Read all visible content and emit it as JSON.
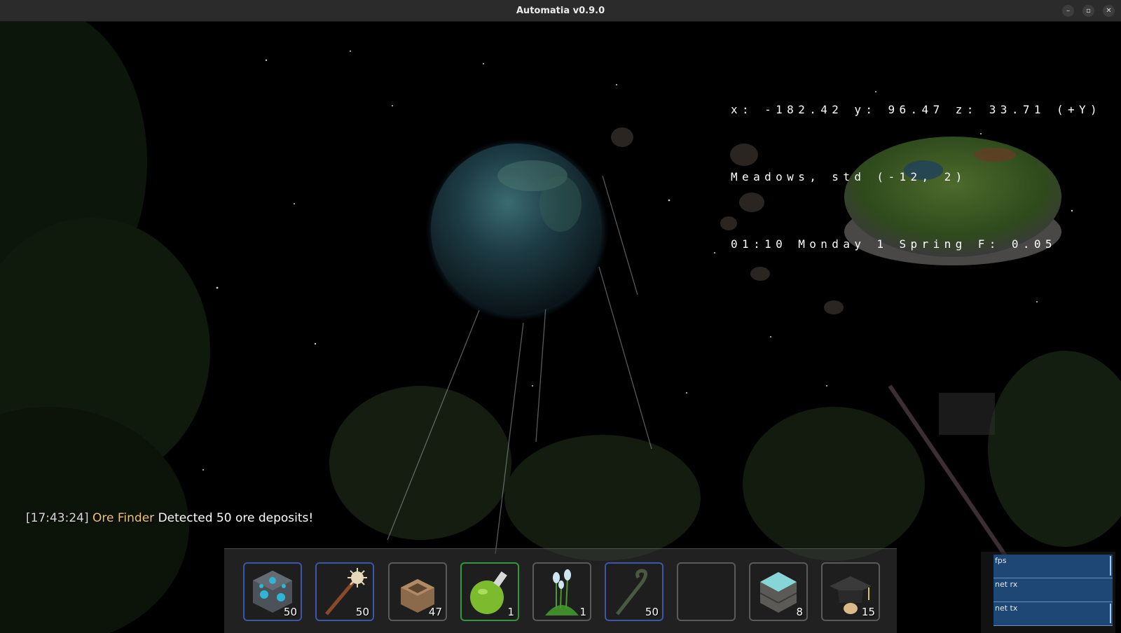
{
  "window": {
    "title": "Automatia v0.9.0",
    "controls": {
      "minimize": "–",
      "maximize": "▫",
      "close": "✕"
    }
  },
  "hud": {
    "coords_line": "x: -182.42 y: 96.47 z: 33.71 (+Y)",
    "biome_line": "Meadows, std (-12, 2)",
    "time_line": "01:10 Monday 1 Spring F: 0.05"
  },
  "chat": {
    "timestamp": "[17:43:24]",
    "source": "Ore Finder",
    "message": "Detected 50 ore deposits!",
    "source_color": "#f0c470"
  },
  "hotbar": {
    "slots": [
      {
        "item": "ore-block-icon",
        "count": "50",
        "selected": true
      },
      {
        "item": "magic-staff-icon",
        "count": "50",
        "selected": true
      },
      {
        "item": "wooden-crate-icon",
        "count": "47",
        "selected": false
      },
      {
        "item": "green-potion-icon",
        "count": "1",
        "selected": true
      },
      {
        "item": "white-flowers-icon",
        "count": "1",
        "selected": false
      },
      {
        "item": "hook-cane-icon",
        "count": "50",
        "selected": true
      },
      {
        "item": "empty-slot",
        "count": "",
        "selected": false
      },
      {
        "item": "crystal-block-icon",
        "count": "8",
        "selected": false
      },
      {
        "item": "graduation-cap-icon",
        "count": "15",
        "selected": false
      }
    ]
  },
  "stats": {
    "fps_label": "fps",
    "net_rx_label": "net rx",
    "net_tx_label": "net tx"
  },
  "colors": {
    "selected_blue": "#3d57a8",
    "selected_green": "#2e9a3c",
    "graph_bg": "#1e4775"
  }
}
